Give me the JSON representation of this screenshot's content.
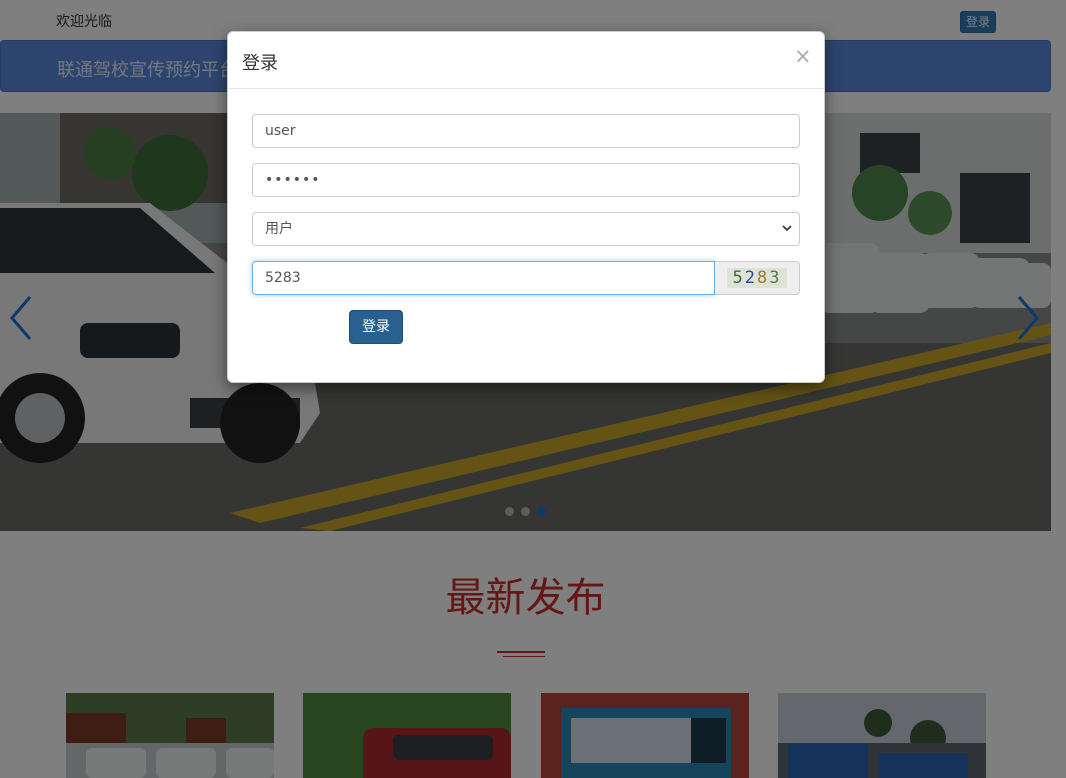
{
  "header": {
    "welcome_text": "欢迎光临",
    "login_button": "登录"
  },
  "banner": {
    "title": "联通驾校宣传预约平台"
  },
  "carousel": {
    "slide_count": 3,
    "active_slide": 3
  },
  "section": {
    "title": "最新发布"
  },
  "login_modal": {
    "title": "登录",
    "close_glyph": "×",
    "username_value": "user",
    "password_value": "••••••",
    "role_selected": "用户",
    "captcha_input_value": "5283",
    "captcha_image_text": "5283",
    "submit_label": "登录"
  },
  "colors": {
    "primary": "#286090",
    "section_title": "#c9302c",
    "banner": "#5b8bdc",
    "carousel_active_dot": "#1a73d9"
  }
}
